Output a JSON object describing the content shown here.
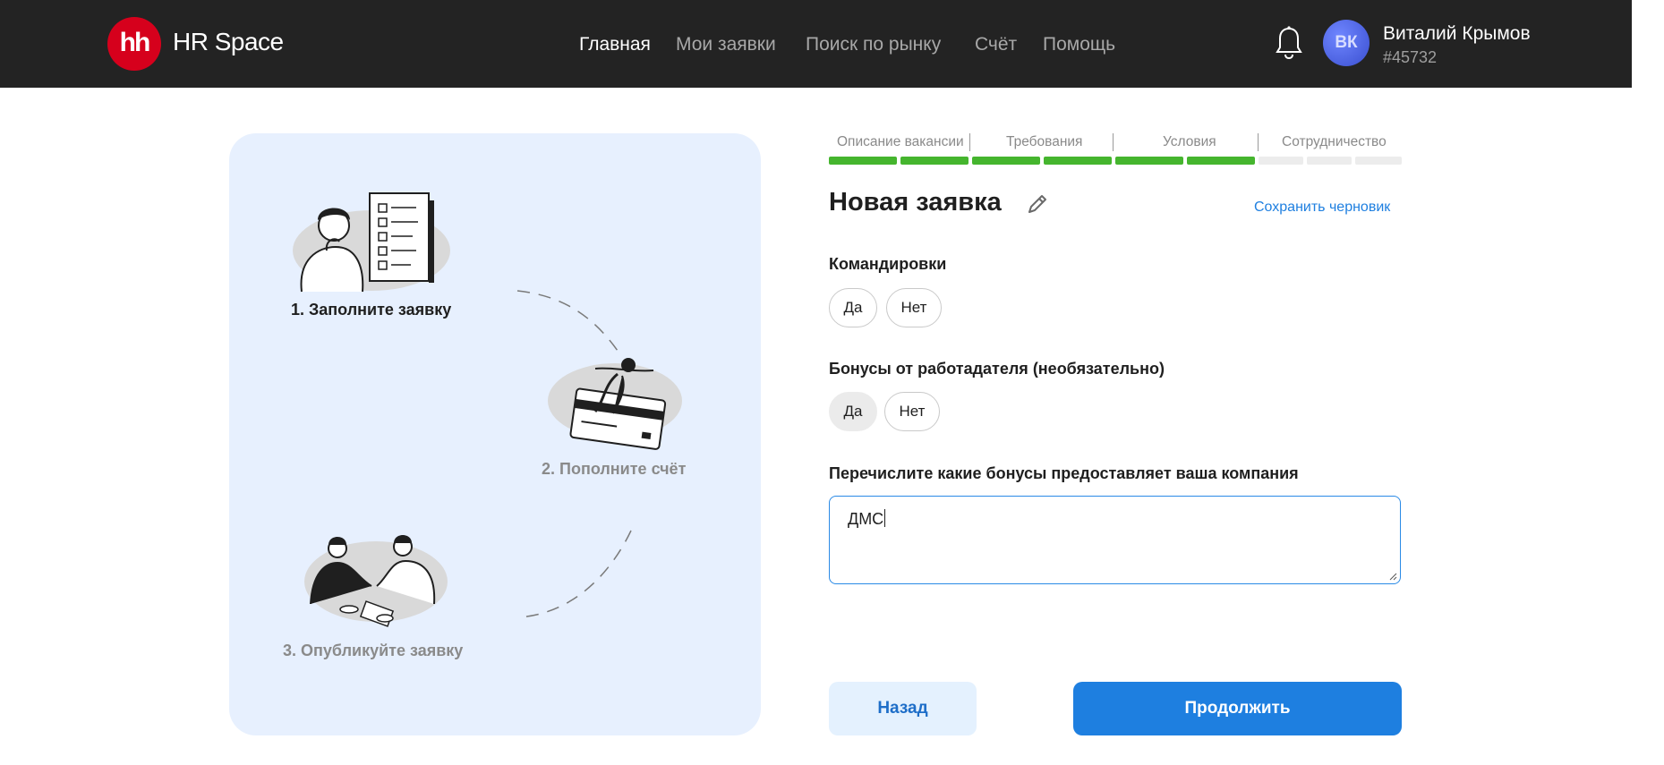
{
  "header": {
    "logo_text": "hh",
    "brand": "HR Space",
    "nav": [
      "Главная",
      "Мои заявки",
      "Поиск по рынку",
      "Счёт",
      "Помощь"
    ],
    "active_nav": "Главная",
    "user": {
      "initials": "ВК",
      "name": "Виталий Крымов",
      "id": "#45732"
    }
  },
  "steps_panel": {
    "steps": [
      "1. Заполните заявку",
      "2. Пополните счёт",
      "3. Опубликуйте заявку"
    ],
    "current_step": 1
  },
  "progress": {
    "sections": [
      "Описание вакансии",
      "Требования",
      "Условия",
      "Сотрудничество"
    ],
    "segments_total": 9,
    "segments_done": 6
  },
  "form": {
    "title": "Новая заявка",
    "save_draft": "Сохранить черновик",
    "business_trips": {
      "label": "Командировки",
      "options": [
        "Да",
        "Нет"
      ],
      "selected": null
    },
    "bonuses": {
      "label": "Бонусы от работадателя (необязательно)",
      "options": [
        "Да",
        "Нет"
      ],
      "selected": "Да"
    },
    "bonus_list": {
      "label": "Перечислите какие бонусы предоставляет ваша компания",
      "value": "ДМС"
    }
  },
  "buttons": {
    "back": "Назад",
    "continue": "Продолжить"
  },
  "colors": {
    "topbar": "#232323",
    "accent": "#1e7fe0",
    "progress_done": "#45b52e",
    "logo": "#d6001c",
    "panel_bg": "#e7f0fe"
  }
}
